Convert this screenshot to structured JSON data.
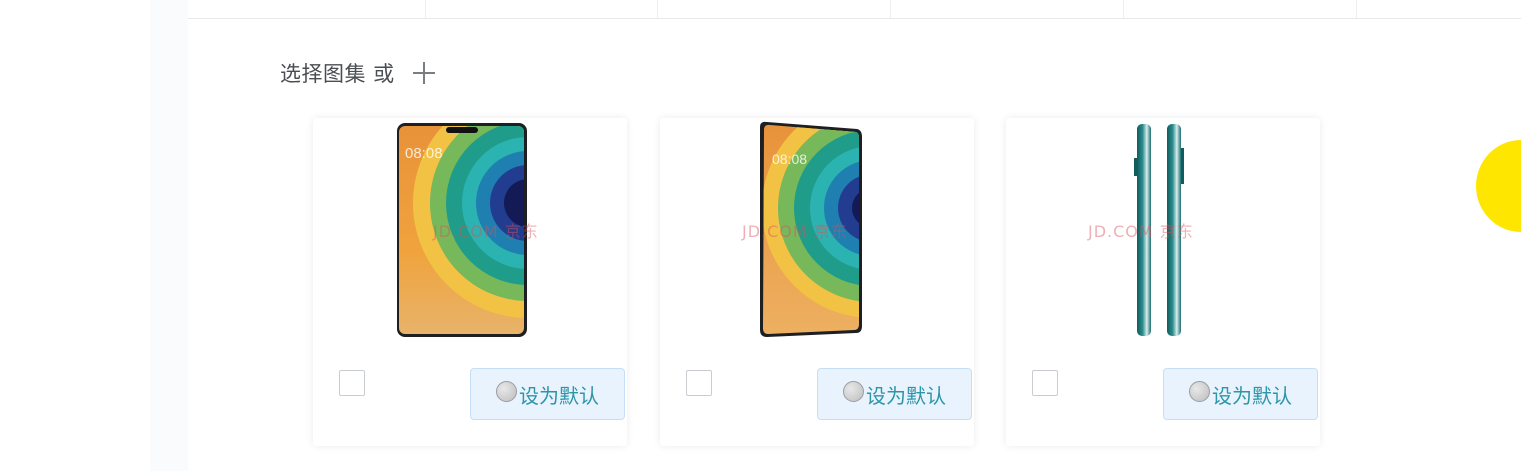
{
  "gallery": {
    "title": "选择图集 或",
    "add_icon": "plus-icon",
    "images": [
      {
        "watermark": "JD.COM 京东",
        "checked": false,
        "default_label": "设为默认",
        "view": "front"
      },
      {
        "watermark": "JD.COM 京东",
        "checked": false,
        "default_label": "设为默认",
        "view": "angled"
      },
      {
        "watermark": "JD.COM 京东",
        "checked": false,
        "default_label": "设为默认",
        "view": "side"
      }
    ]
  },
  "colors": {
    "button_bg": "#e9f3fd",
    "button_text": "#2c95a8",
    "cursor_highlight": "#ffe600"
  }
}
